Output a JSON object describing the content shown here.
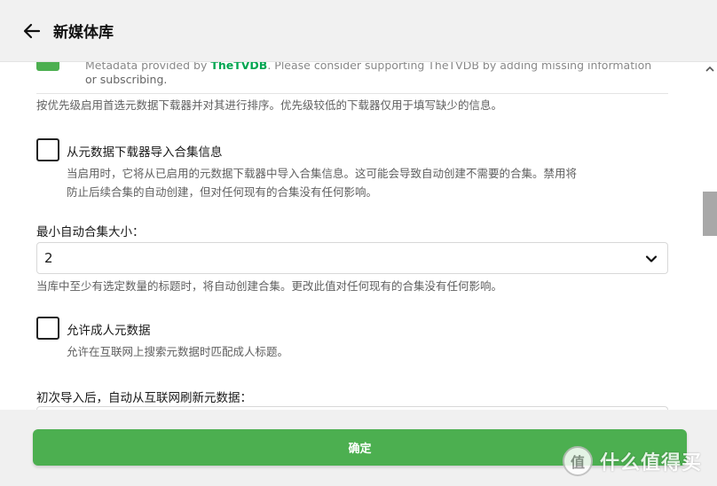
{
  "header": {
    "title": "新媒体库"
  },
  "metadata_item": {
    "text_prefix": "Metadata provided by ",
    "link": "TheTVDB",
    "text_suffix": ". Please consider supporting TheTVDB by adding missing information",
    "text_line2": "or subscribing."
  },
  "downloader_hint": "按优先级启用首选元数据下载器并对其进行排序。优先级较低的下载器仅用于填写缺少的信息。",
  "import_collections": {
    "label": "从元数据下载器导入合集信息",
    "desc_line1": "当启用时，它将从已启用的元数据下载器中导入合集信息。这可能会导致自动创建不需要的合集。禁用将",
    "desc_line2": "防止后续合集的自动创建，但对任何现有的合集没有任何影响。",
    "checked": false
  },
  "min_collection_size": {
    "label": "最小自动合集大小：",
    "value": "2",
    "desc": "当库中至少有选定数量的标题时，将自动创建合集。更改此值对任何现有的合集没有任何影响。"
  },
  "adult_metadata": {
    "label": "允许成人元数据",
    "desc": "允许在互联网上搜索元数据时匹配成人标题。",
    "checked": false
  },
  "refresh_after_import": {
    "label": "初次导入后，自动从互联网刷新元数据："
  },
  "footer": {
    "confirm_label": "确定"
  },
  "watermark": {
    "badge": "值",
    "text": "什么值得买"
  },
  "colors": {
    "accent": "#4caf50",
    "link": "#00a651"
  }
}
